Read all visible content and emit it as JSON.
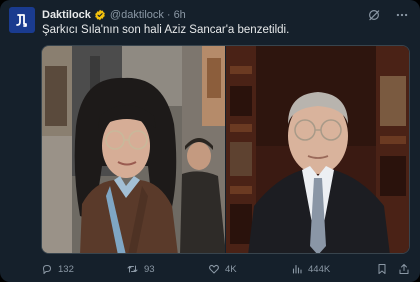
{
  "tweet": {
    "author_name": "Daktilock",
    "author_handle": "@daktilock",
    "separator": "·",
    "time": "6h",
    "text": "Şarkıcı Sıla'nın son hali Aziz Sancar'a benzetildi."
  },
  "icons": {
    "avatar": "daktilock-logo",
    "verified": "verified-badge-icon",
    "grok": "grok-icon",
    "more": "more-dots-icon",
    "reply": "reply-icon",
    "retweet": "retweet-icon",
    "like": "heart-icon",
    "views": "views-bar-icon",
    "bookmark": "bookmark-icon",
    "share": "share-icon"
  },
  "stats": {
    "replies": "132",
    "retweets": "93",
    "likes": "4K",
    "views": "444K"
  },
  "colors": {
    "background": "#15202b",
    "text": "#e7e9ea",
    "muted": "#8b98a5",
    "verified": "#f4c20d",
    "avatar": "#1a3b8f"
  }
}
